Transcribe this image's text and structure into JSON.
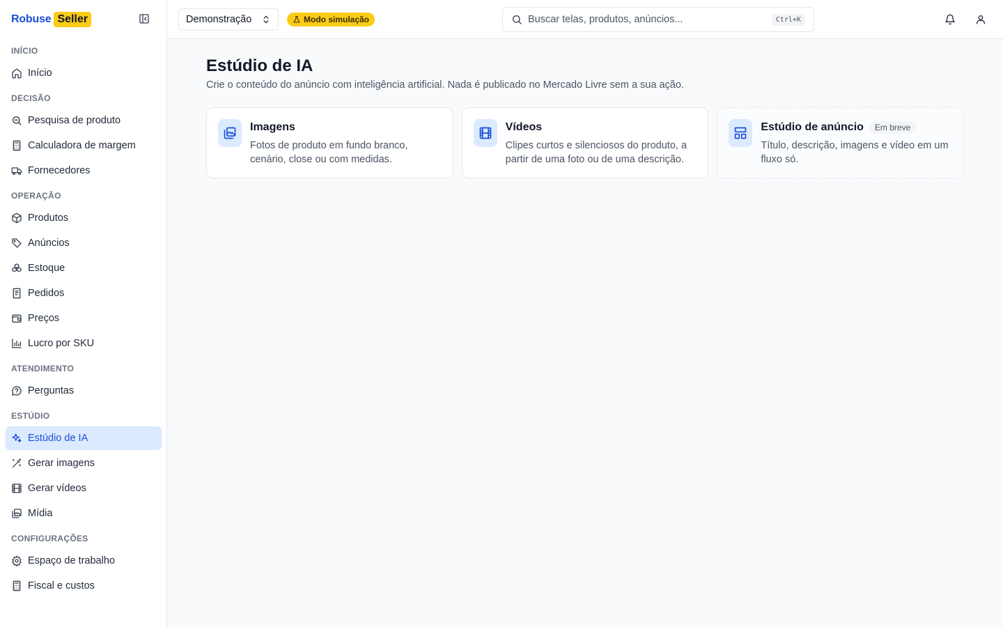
{
  "brand": {
    "name_a": "Robuse",
    "name_b": "Seller"
  },
  "header": {
    "workspace": "Demonstração",
    "mode_badge": "Modo simulação",
    "search_placeholder": "Buscar telas, produtos, anúncios...",
    "search_shortcut": "Ctrl+K"
  },
  "sidebar": {
    "sections": [
      {
        "label": "INÍCIO",
        "items": [
          {
            "label": "Início",
            "icon": "home-icon"
          }
        ]
      },
      {
        "label": "DECISÃO",
        "items": [
          {
            "label": "Pesquisa de produto",
            "icon": "search-icon"
          },
          {
            "label": "Calculadora de margem",
            "icon": "calculator-icon"
          },
          {
            "label": "Fornecedores",
            "icon": "truck-icon"
          }
        ]
      },
      {
        "label": "OPERAÇÃO",
        "items": [
          {
            "label": "Produtos",
            "icon": "package-icon"
          },
          {
            "label": "Anúncios",
            "icon": "tag-icon"
          },
          {
            "label": "Estoque",
            "icon": "boxes-icon"
          },
          {
            "label": "Pedidos",
            "icon": "receipt-icon"
          },
          {
            "label": "Preços",
            "icon": "wallet-icon"
          },
          {
            "label": "Lucro por SKU",
            "icon": "chart-icon"
          }
        ]
      },
      {
        "label": "ATENDIMENTO",
        "items": [
          {
            "label": "Perguntas",
            "icon": "question-icon"
          }
        ]
      },
      {
        "label": "ESTÚDIO",
        "items": [
          {
            "label": "Estúdio de IA",
            "icon": "sparkles-icon",
            "active": true
          },
          {
            "label": "Gerar imagens",
            "icon": "wand-icon"
          },
          {
            "label": "Gerar vídeos",
            "icon": "film-icon"
          },
          {
            "label": "Mídia",
            "icon": "images-icon"
          }
        ]
      },
      {
        "label": "CONFIGURAÇÕES",
        "items": [
          {
            "label": "Espaço de trabalho",
            "icon": "gear-icon"
          },
          {
            "label": "Fiscal e custos",
            "icon": "calculator-icon"
          }
        ]
      }
    ]
  },
  "main": {
    "title": "Estúdio de IA",
    "subtitle": "Crie o conteúdo do anúncio com inteligência artificial. Nada é publicado no Mercado Livre sem a sua ação.",
    "cards": [
      {
        "title": "Imagens",
        "description": "Fotos de produto em fundo branco, cenário, close ou com medidas.",
        "icon": "image-plus-icon"
      },
      {
        "title": "Vídeos",
        "description": "Clipes curtos e silenciosos do produto, a partir de uma foto ou de uma descrição.",
        "icon": "film-icon"
      },
      {
        "title": "Estúdio de anúncio",
        "badge": "Em breve",
        "description": "Título, descrição, imagens e vídeo em um fluxo só.",
        "icon": "layout-icon"
      }
    ]
  },
  "colors": {
    "accent": "#1d4ed8",
    "accent_bg": "#dbeafe",
    "badge": "#facc15"
  }
}
